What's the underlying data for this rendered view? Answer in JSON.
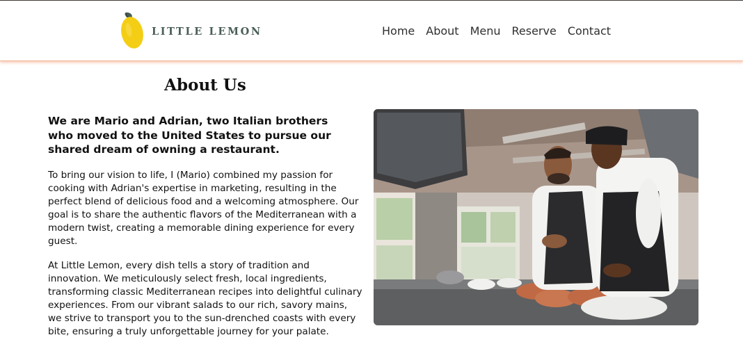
{
  "brand": {
    "name": "LITTLE LEMON",
    "logo_icon": "lemon-icon",
    "name_color": "#495e57",
    "lemon_color": "#f4ce14"
  },
  "nav": {
    "items": [
      "Home",
      "About",
      "Menu",
      "Reserve",
      "Contact"
    ]
  },
  "about": {
    "title": "About Us",
    "lead": "We are Mario and Adrian, two Italian brothers who moved to the United States to pursue our shared dream of owning a restaurant.",
    "paragraph1": "To bring our vision to life, I (Mario) combined my passion for cooking with Adrian's expertise in marketing, resulting in the perfect blend of delicious food and a welcoming atmosphere. Our goal is to share the authentic flavors of the Mediterranean with a modern twist, creating a memorable dining experience for every guest.",
    "paragraph2": "At Little Lemon, every dish tells a story of tradition and innovation. We meticulously select fresh, local ingredients, transforming classic Mediterranean recipes into delightful culinary experiences. From our vibrant salads to our rich, savory mains, we strive to transport you to the sun-drenched coasts with every bite, ensuring a truly unforgettable journey for your palate."
  },
  "photo": {
    "subject": "two chefs in a restaurant kitchen",
    "header_shadow_color": "#ee9972"
  }
}
